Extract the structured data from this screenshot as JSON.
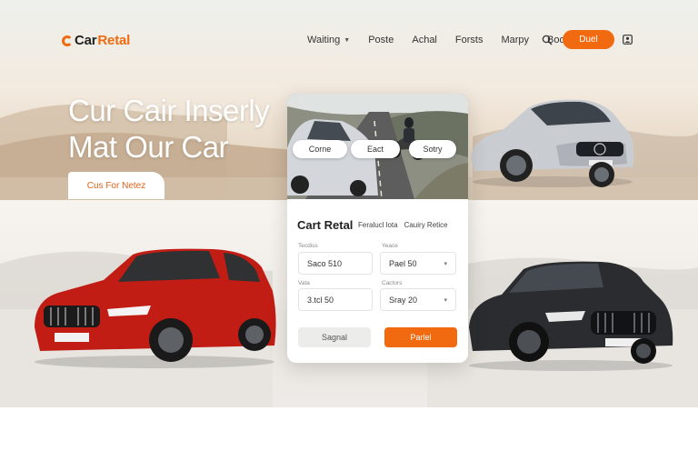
{
  "brand": {
    "name_prefix": "Car",
    "name_suffix": "Retal",
    "accent_color": "#f26a10"
  },
  "nav": {
    "links": [
      "Waiting",
      "Poste",
      "Achal",
      "Forsts",
      "Marpy",
      "Book"
    ],
    "cta_label": "Duel"
  },
  "hero": {
    "title_line1": "Cur Cair Inserly",
    "title_line2": "Mat Our Car",
    "cta_label": "Cus For Netez"
  },
  "card": {
    "chips": [
      "Corne",
      "Eact",
      "Sotry"
    ],
    "title": "Cart Retal",
    "tabs": [
      "Feralucl lota",
      "Cauiry Retice"
    ],
    "fields": [
      {
        "label": "Tecdiss",
        "value": "Saco 510"
      },
      {
        "label": "Yeace",
        "value": "Pael 50"
      },
      {
        "label": "Vata",
        "value": "3.tcl 50"
      },
      {
        "label": "Cactors",
        "value": "Sray 20"
      }
    ],
    "secondary_button": "Sagnal",
    "primary_button": "Parlel"
  },
  "icons": {
    "search": "search-icon",
    "user": "user-icon",
    "dropdown": "chevron-down-icon"
  }
}
